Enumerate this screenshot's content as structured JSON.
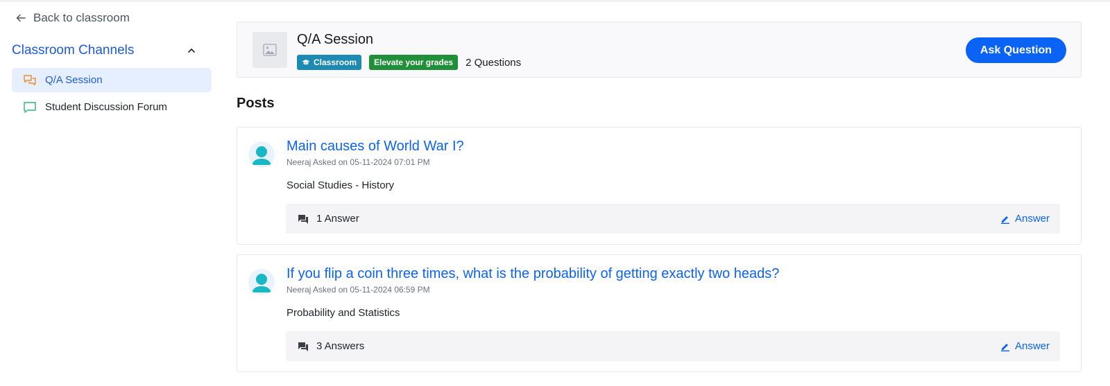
{
  "sidebar": {
    "back_label": "Back to classroom",
    "channels_title": "Classroom Channels",
    "channels": [
      {
        "label": "Q/A Session",
        "active": true,
        "icon": "chat-bubbles-icon"
      },
      {
        "label": "Student Discussion Forum",
        "active": false,
        "icon": "chat-bubble-icon"
      }
    ]
  },
  "session": {
    "title": "Q/A Session",
    "badge_classroom": "Classroom",
    "badge_tagline": "Elevate your grades",
    "question_count": "2 Questions",
    "ask_button": "Ask Question"
  },
  "posts_heading": "Posts",
  "posts": [
    {
      "title": "Main causes of World War I?",
      "meta": "Neeraj Asked on 05-11-2024 07:01 PM",
      "body": "Social Studies - History",
      "answers": "1 Answer",
      "answer_button": "Answer"
    },
    {
      "title": "If you flip a coin three times, what is the probability of getting exactly two heads?",
      "meta": "Neeraj Asked on 05-11-2024 06:59 PM",
      "body": "Probability and Statistics",
      "answers": "3 Answers",
      "answer_button": "Answer"
    }
  ],
  "colors": {
    "accent": "#0b63f6",
    "channel_active_bg": "#e6efff",
    "badge_teal": "#1d8ab3",
    "badge_green": "#1f8f3a",
    "avatar": "#17b8c4",
    "chat_orange": "#f08a24",
    "chat_green": "#2bb673"
  }
}
